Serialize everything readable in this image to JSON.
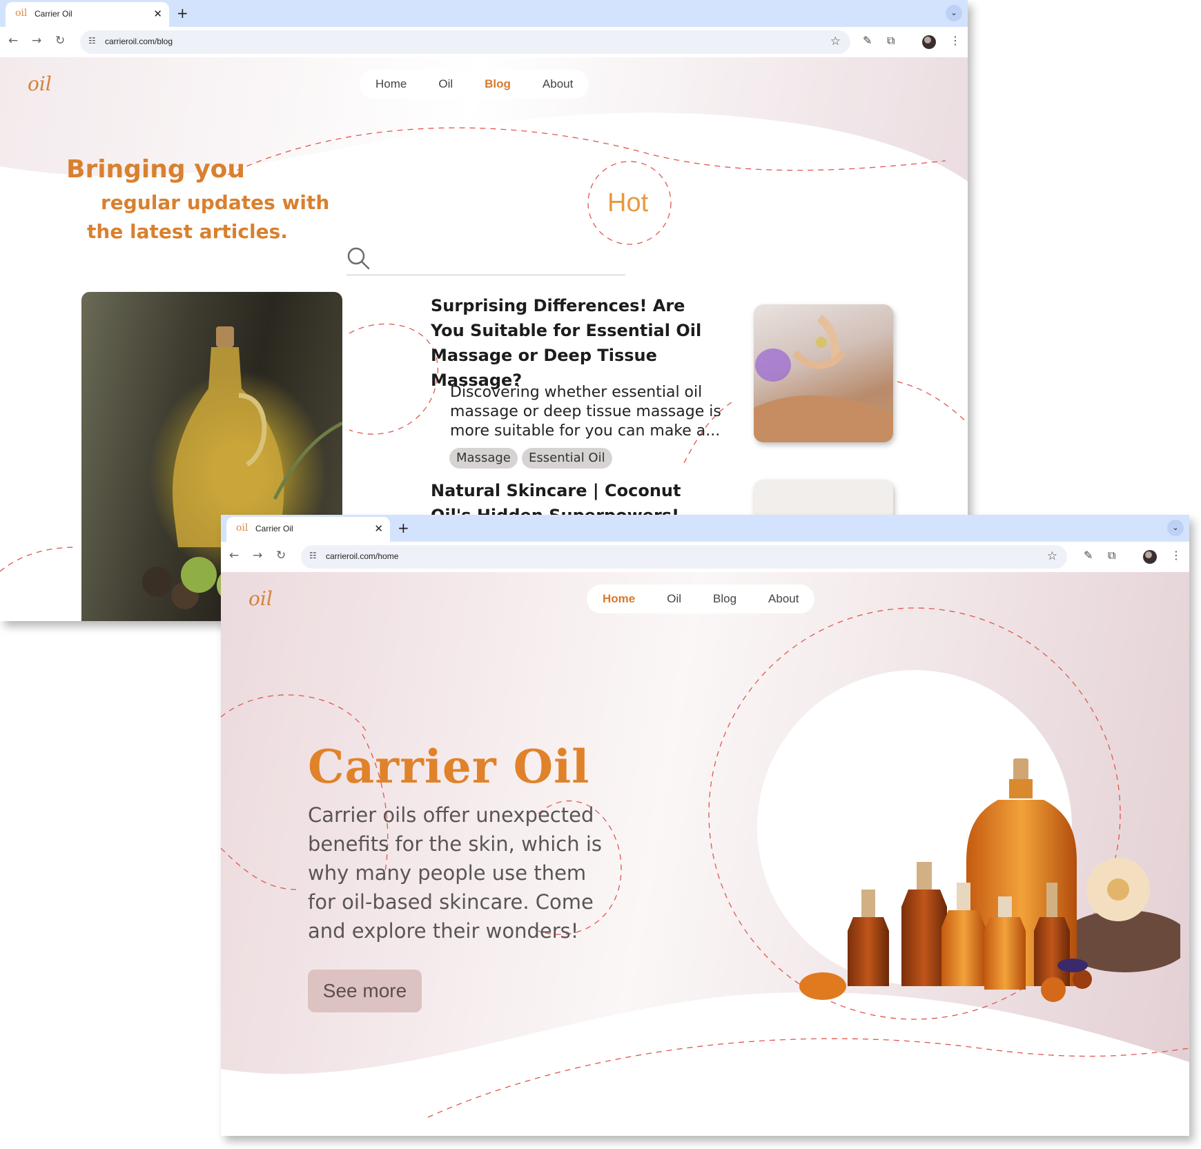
{
  "blog_window": {
    "tab": {
      "favicon": "oil",
      "title": "Carrier Oil"
    },
    "url": "carrieroil.com/blog",
    "logo": "oil",
    "nav": [
      "Home",
      "Oil",
      "Blog",
      "About"
    ],
    "active_nav": "Blog",
    "hero": {
      "line1": "Bringing you",
      "line2": "regular updates with",
      "line3": "the latest articles."
    },
    "hot_label": "Hot",
    "search": {
      "placeholder": ""
    },
    "articles": [
      {
        "title": "Surprising Differences! Are You Suitable for Essential Oil Massage or Deep Tissue Massage?",
        "excerpt": "Discovering whether essential oil massage or deep tissue massage is more suitable for you can make a...",
        "tags": [
          "Massage",
          "Essential Oil"
        ]
      },
      {
        "title": "Natural Skincare | Coconut Oil's Hidden Superpowers! Loved by"
      }
    ]
  },
  "home_window": {
    "tab": {
      "favicon": "oil",
      "title": "Carrier Oil"
    },
    "url": "carrieroil.com/home",
    "logo": "oil",
    "nav": [
      "Home",
      "Oil",
      "Blog",
      "About"
    ],
    "active_nav": "Home",
    "title": "Carrier Oil",
    "lead": "Carrier oils offer unexpected benefits for the skin, which is why many people use them for oil-based skincare. Come and explore their wonders!",
    "cta": "See more"
  },
  "colors": {
    "accent": "#d9802f",
    "tab_strip": "#d3e3fd",
    "dashed_line": "#e0554d",
    "cta_bg": "#dcc2c0"
  }
}
